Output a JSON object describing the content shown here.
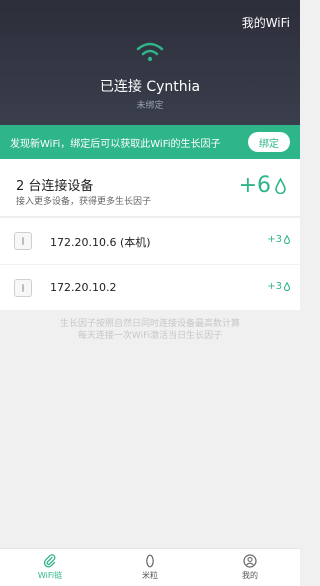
{
  "header": {
    "my_wifi_link": "我的WiFi",
    "status_title": "已连接 Cynthia",
    "status_sub": "未绑定",
    "wifi_color": "#2fb58a"
  },
  "bind_banner": {
    "text": "发现新WiFi，绑定后可以获取此WiFi的生长因子",
    "button_label": "绑定"
  },
  "summary": {
    "device_count_text": "2 台连接设备",
    "hint": "接入更多设备，获得更多生长因子",
    "bonus": "+6"
  },
  "devices": [
    {
      "name": "172.20.10.6 (本机)",
      "bonus": "+3"
    },
    {
      "name": "172.20.10.2",
      "bonus": "+3"
    }
  ],
  "footnote": {
    "line1": "生长因子按照自然日同时连接设备最高数计算",
    "line2": "每天连接一次WiFi激活当日生长因子"
  },
  "tabs": [
    {
      "label": "WiFi链",
      "icon": "paperclip-icon",
      "active": true
    },
    {
      "label": "米粒",
      "icon": "rice-grain-icon",
      "active": false
    },
    {
      "label": "我的",
      "icon": "user-icon",
      "active": false
    }
  ],
  "accent_color": "#2fb58a"
}
